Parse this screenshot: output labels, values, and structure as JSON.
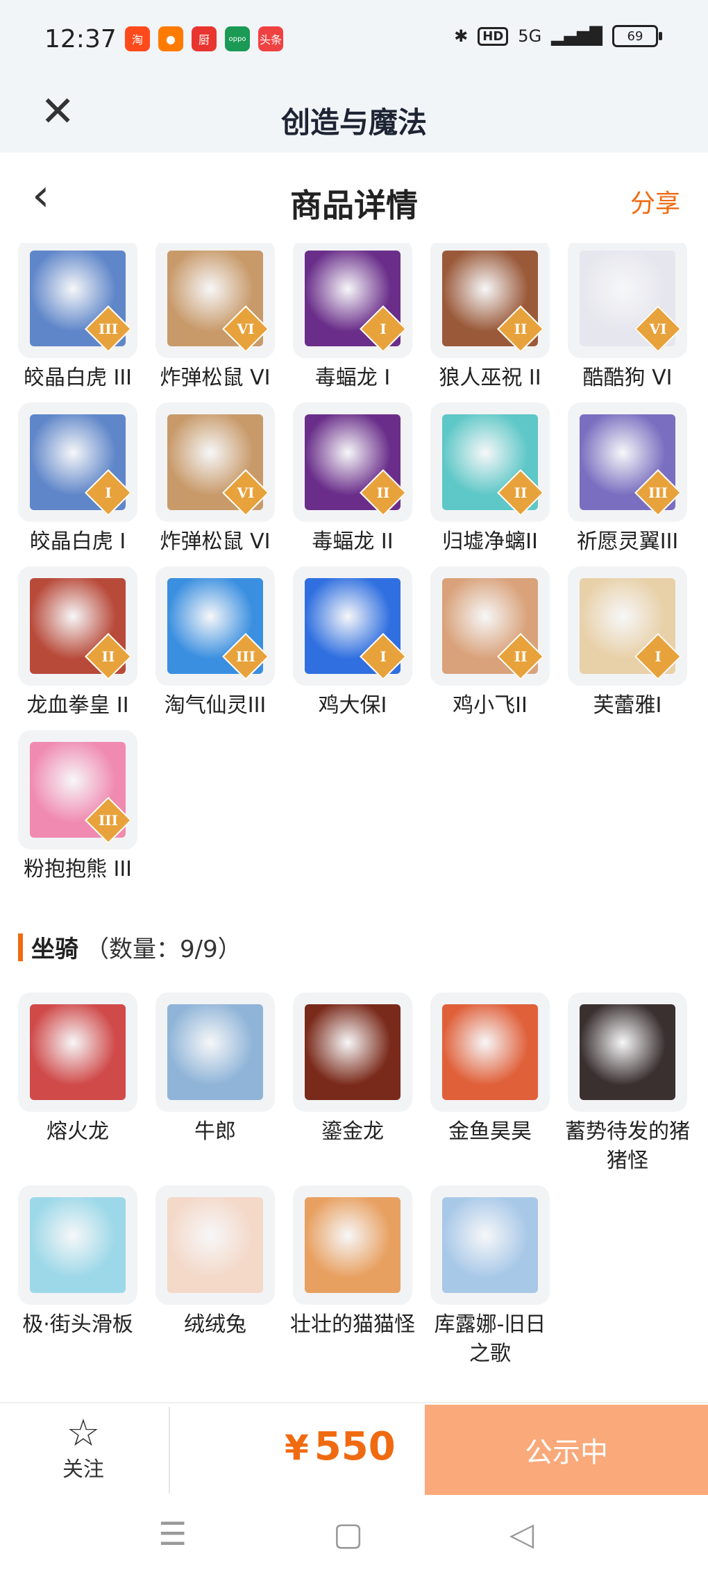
{
  "status_bar": {
    "time": "12:37",
    "apps": [
      {
        "name": "taobao-app-icon",
        "glyph": "淘",
        "color": "#ff4a1c"
      },
      {
        "name": "weibo-app-icon",
        "glyph": "●",
        "color": "#ff7a00"
      },
      {
        "name": "kitchen-app-icon",
        "glyph": "厨",
        "color": "#e8352f"
      },
      {
        "name": "oppo-app-icon",
        "glyph": "oppo",
        "color": "#1a9a55"
      },
      {
        "name": "toutiao-app-icon",
        "glyph": "头条",
        "color": "#f04142"
      }
    ],
    "hd": "HD",
    "network": "5G",
    "battery": "69"
  },
  "app_bar": {
    "title": "创造与魔法"
  },
  "nav_bar": {
    "title": "商品详情",
    "share": "分享"
  },
  "pets": [
    {
      "label": "皎晶白虎 III",
      "rank": "III",
      "color": "#5f86c9"
    },
    {
      "label": "炸弹松鼠 VI",
      "rank": "VI",
      "color": "#c89a6a"
    },
    {
      "label": "毒蝠龙 I",
      "rank": "I",
      "color": "#6a2e8a"
    },
    {
      "label": "狼人巫祝 II",
      "rank": "II",
      "color": "#9a5a3a"
    },
    {
      "label": "酷酷狗 VI",
      "rank": "VI",
      "color": "#e6e6ee"
    },
    {
      "label": "皎晶白虎 I",
      "rank": "I",
      "color": "#5f86c9"
    },
    {
      "label": "炸弹松鼠 VI",
      "rank": "VI",
      "color": "#c89a6a"
    },
    {
      "label": "毒蝠龙 II",
      "rank": "II",
      "color": "#6a2e8a"
    },
    {
      "label": "归墟净螭II",
      "rank": "II",
      "color": "#5ec7c7"
    },
    {
      "label": "祈愿灵翼III",
      "rank": "III",
      "color": "#7a6ec0"
    },
    {
      "label": "龙血拳皇 II",
      "rank": "II",
      "color": "#b84a3a"
    },
    {
      "label": "淘气仙灵III",
      "rank": "III",
      "color": "#3a8fe0"
    },
    {
      "label": "鸡大保I",
      "rank": "I",
      "color": "#2f6fe0"
    },
    {
      "label": "鸡小飞II",
      "rank": "II",
      "color": "#d9a27a"
    },
    {
      "label": "芙蕾雅I",
      "rank": "I",
      "color": "#e8d0a8"
    },
    {
      "label": "粉抱抱熊 III",
      "rank": "III",
      "color": "#f08ab0"
    }
  ],
  "mounts_section": {
    "name": "坐骑",
    "count": "（数量：9/9）"
  },
  "mounts": [
    {
      "label": "熔火龙",
      "color": "#d04a4a"
    },
    {
      "label": "牛郎",
      "color": "#8fb4d8"
    },
    {
      "label": "鎏金龙",
      "color": "#7a2a1a"
    },
    {
      "label": "金鱼昊昊",
      "color": "#e0603a"
    },
    {
      "label": "蓄势待发的猪猪怪",
      "color": "#3a3030"
    },
    {
      "label": "极·街头滑板",
      "color": "#9cd8e8"
    },
    {
      "label": "绒绒兔",
      "color": "#f4d8c8"
    },
    {
      "label": "壮壮的猫猫怪",
      "color": "#e8a060"
    },
    {
      "label": "库露娜-旧日之歌",
      "color": "#a8c8e8"
    }
  ],
  "bottom_bar": {
    "favorite_label": "关注",
    "currency": "¥",
    "price": "550",
    "action_label": "公示中"
  }
}
